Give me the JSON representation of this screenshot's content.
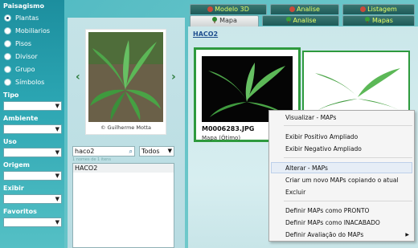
{
  "sidebar": {
    "title": "Paisagismo",
    "options": [
      {
        "label": "Plantas",
        "selected": true
      },
      {
        "label": "Mobiliarios",
        "selected": false
      },
      {
        "label": "Pisos",
        "selected": false
      },
      {
        "label": "Divisor",
        "selected": false
      },
      {
        "label": "Grupo",
        "selected": false
      },
      {
        "label": "Símbolos",
        "selected": false
      }
    ],
    "filters": [
      "Tipo",
      "Ambiente",
      "Uso",
      "Origem",
      "Exibir",
      "Favoritos"
    ]
  },
  "tabs": {
    "row1": [
      "Modelo 3D",
      "Analise",
      "Listagem"
    ],
    "row2": [
      "Mapa",
      "Analise",
      "Mapas"
    ]
  },
  "middle": {
    "caption": "© Guilherme Motta",
    "search_value": "haco2",
    "filter_value": "Todos",
    "count_text": "1 nomes de 1 itens",
    "results": [
      "HACO2"
    ]
  },
  "content": {
    "breadcrumb": "HACO2",
    "card1_name": "M0006283.JPG",
    "card1_sub": "Mapa (Ótimo)"
  },
  "context_menu": {
    "items": [
      "Visualizar - MAPs",
      "Exibir Positivo Ampliado",
      "Exibir Negativo Ampliado",
      "Alterar - MAPs",
      "Criar um novo MAPs copiando o atual",
      "Excluir",
      "Definir MAPs como PRONTO",
      "Definir MAPs como INACABADO",
      "Definir Avaliação do MAPs"
    ],
    "highlighted_index": 3
  },
  "colors": {
    "accent_green": "#2e9a3e",
    "tab_dark": "#1e5b59",
    "tab_text": "#e7ff66",
    "sidebar": "#2ba5b2"
  }
}
